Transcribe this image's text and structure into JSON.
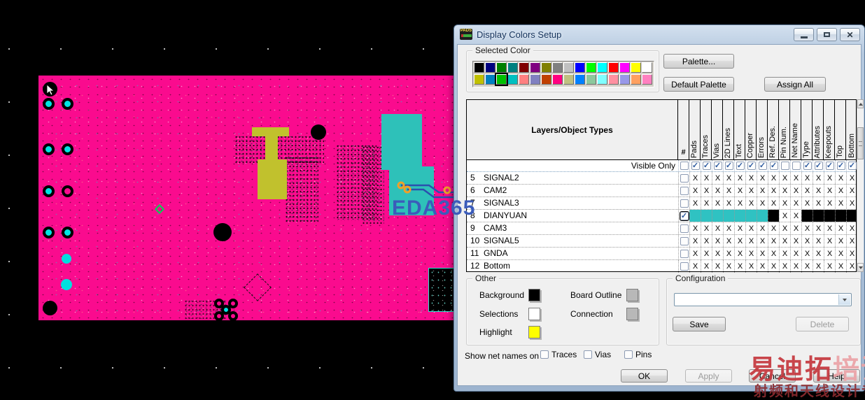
{
  "window": {
    "title": "Display Colors Setup"
  },
  "selected_color": {
    "label": "Selected Color",
    "rows": [
      [
        "#000000",
        "#000080",
        "#008000",
        "#008080",
        "#800000",
        "#800080",
        "#808000",
        "#808080",
        "#c0c0c0",
        "#0000ff",
        "#00ff00",
        "#00ffff",
        "#ff0000",
        "#ff00ff",
        "#ffff00",
        "#ffffff"
      ],
      [
        "#c0c000",
        "#0080c0",
        "#00c000",
        "#00c0c0",
        "#ff8080",
        "#8080c0",
        "#c04000",
        "#ff0080",
        "#c0c080",
        "#0080ff",
        "#8cc89c",
        "#80ffff",
        "#ff90a0",
        "#9898e8",
        "#ffa060",
        "#ff80c0"
      ]
    ],
    "selected": {
      "row": 1,
      "col": 2
    }
  },
  "buttons": {
    "palette": "Palette...",
    "default_palette": "Default Palette",
    "assign_all": "Assign All",
    "ok": "OK",
    "apply": "Apply",
    "cancel": "Cancel",
    "help": "Help"
  },
  "table": {
    "header": "Layers/Object Types",
    "hash_col": "#",
    "columns": [
      "Pads",
      "Traces",
      "Vias",
      "2D Lines",
      "Text",
      "Copper",
      "Errors",
      "Ref. Des.",
      "Pin Num.",
      "Net Name",
      "Type",
      "Attributes",
      "Keepouts",
      "Top",
      "Bottom"
    ],
    "visible_only": {
      "label": "Visible Only",
      "checks": [
        false,
        true,
        true,
        true,
        true,
        true,
        true,
        true,
        true,
        false,
        false,
        true,
        true,
        true,
        true,
        true
      ]
    },
    "cell_colors": {
      "cyan": "#2fc2c2",
      "black": "#000000"
    },
    "rows": [
      {
        "num": "5",
        "name": "SIGNAL2",
        "checked": false,
        "cells": [
          "x",
          "x",
          "x",
          "x",
          "x",
          "x",
          "x",
          "x",
          "x",
          "x",
          "x",
          "x",
          "x",
          "x",
          "x"
        ]
      },
      {
        "num": "6",
        "name": "CAM2",
        "checked": false,
        "cells": [
          "x",
          "x",
          "x",
          "x",
          "x",
          "x",
          "x",
          "x",
          "x",
          "x",
          "x",
          "x",
          "x",
          "x",
          "x"
        ]
      },
      {
        "num": "7",
        "name": "SIGNAL3",
        "checked": false,
        "cells": [
          "x",
          "x",
          "x",
          "x",
          "x",
          "x",
          "x",
          "x",
          "x",
          "x",
          "x",
          "x",
          "x",
          "x",
          "x"
        ]
      },
      {
        "num": "8",
        "name": "DIANYUAN",
        "checked": true,
        "cells": [
          "cyan",
          "cyan",
          "cyan",
          "cyan",
          "cyan",
          "cyan",
          "cyan",
          "black",
          "x",
          "x",
          "black",
          "black",
          "black",
          "black",
          "black"
        ]
      },
      {
        "num": "9",
        "name": "CAM3",
        "checked": false,
        "cells": [
          "x",
          "x",
          "x",
          "x",
          "x",
          "x",
          "x",
          "x",
          "x",
          "x",
          "x",
          "x",
          "x",
          "x",
          "x"
        ]
      },
      {
        "num": "10",
        "name": "SIGNAL5",
        "checked": false,
        "cells": [
          "x",
          "x",
          "x",
          "x",
          "x",
          "x",
          "x",
          "x",
          "x",
          "x",
          "x",
          "x",
          "x",
          "x",
          "x"
        ]
      },
      {
        "num": "11",
        "name": "GNDA",
        "checked": false,
        "cells": [
          "x",
          "x",
          "x",
          "x",
          "x",
          "x",
          "x",
          "x",
          "x",
          "x",
          "x",
          "x",
          "x",
          "x",
          "x"
        ]
      },
      {
        "num": "12",
        "name": "Bottom",
        "checked": false,
        "cells": [
          "x",
          "x",
          "x",
          "x",
          "x",
          "x",
          "x",
          "x",
          "x",
          "x",
          "x",
          "x",
          "x",
          "x",
          "x"
        ]
      }
    ]
  },
  "other": {
    "label": "Other",
    "items": [
      {
        "label": "Background",
        "color": "#000000"
      },
      {
        "label": "Selections",
        "color": "#ffffff"
      },
      {
        "label": "Highlight",
        "color": "#ffff00"
      },
      {
        "label": "Board Outline",
        "color": "#b8b8b8"
      },
      {
        "label": "Connection",
        "color": "#b8b8b8"
      }
    ]
  },
  "configuration": {
    "label": "Configuration",
    "dropdown_value": "",
    "save": "Save",
    "delete": "Delete"
  },
  "show_net_names": {
    "label": "Show net names on",
    "options": [
      {
        "label": "Traces",
        "checked": false
      },
      {
        "label": "Vias",
        "checked": false
      },
      {
        "label": "Pins",
        "checked": false
      }
    ]
  },
  "pcb": {
    "board_color": "#fa0b8e",
    "copper_shape_color": "#2ec1b9",
    "plane_shape_color": "#c1c12d",
    "trace_color": "#2b4fae",
    "via_color": "#f0a028",
    "watermark_text": "EDA365",
    "watermark_color": "#3b5cba"
  },
  "watermark": {
    "title_strong": "易迪拓",
    "title_light": "培训",
    "subtitle": "射频和天线设计专家"
  },
  "app_icon_text": "PADS"
}
